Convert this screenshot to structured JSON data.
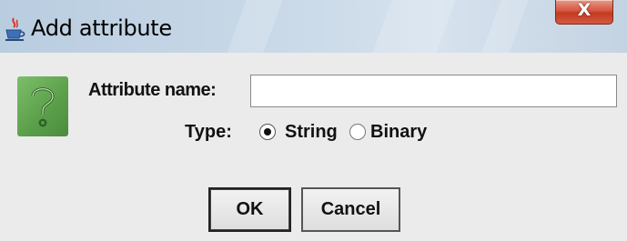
{
  "window": {
    "title": "Add attribute",
    "close_label": "X"
  },
  "form": {
    "attribute_name_label": "Attribute name:",
    "attribute_name_value": "",
    "type_label": "Type:",
    "type_options": [
      {
        "label": "String",
        "selected": true
      },
      {
        "label": "Binary",
        "selected": false
      }
    ]
  },
  "buttons": {
    "ok_label": "OK",
    "cancel_label": "Cancel"
  },
  "icons": {
    "app": "java-cup-icon",
    "dialog": "question-icon",
    "close": "close-icon"
  },
  "colors": {
    "titlebar": "#c9d9e8",
    "dialog_bg": "#ebebeb",
    "question_icon": "#5a9e4a",
    "close_button": "#d4563e"
  }
}
